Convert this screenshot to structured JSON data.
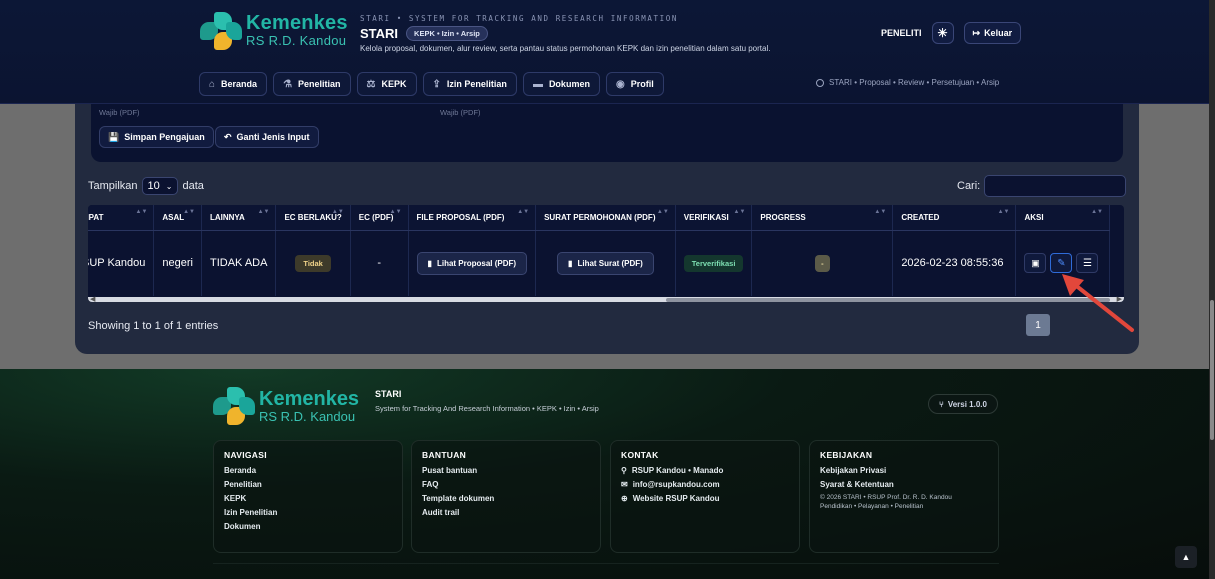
{
  "header": {
    "brand_line1": "Kemenkes",
    "brand_line2": "RS R.D. Kandou",
    "tagline": "STARI • SYSTEM FOR TRACKING AND RESEARCH INFORMATION",
    "app_title": "STARI",
    "pill": "KEPK • Izin • Arsip",
    "subtitle": "Kelola proposal, dokumen, alur review, serta pantau status permohonan KEPK dan izin penelitian dalam satu portal.",
    "role": "PENELITI",
    "logout_label": "Keluar",
    "breadcrumb": "STARI • Proposal • Review • Persetujuan • Arsip"
  },
  "nav": [
    {
      "label": "Beranda",
      "icon": "home-icon"
    },
    {
      "label": "Penelitian",
      "icon": "flask-icon"
    },
    {
      "label": "KEPK",
      "icon": "scale-icon"
    },
    {
      "label": "Izin Penelitian",
      "icon": "upload-icon"
    },
    {
      "label": "Dokumen",
      "icon": "folder-icon"
    },
    {
      "label": "Profil",
      "icon": "user-circle-icon"
    }
  ],
  "form": {
    "hint_left": "Wajib (PDF)",
    "hint_right": "Wajib (PDF)",
    "save_label": "Simpan Pengajuan",
    "switch_label": "Ganti Jenis Input"
  },
  "table_controls": {
    "show_prefix": "Tampilkan",
    "show_value": "10",
    "show_suffix": "data",
    "search_label": "Cari:",
    "search_value": ""
  },
  "table": {
    "headers": [
      "MPAT",
      "ASAL",
      "LAINNYA",
      "EC BERLAKU?",
      "EC (PDF)",
      "FILE PROPOSAL (PDF)",
      "SURAT PERMOHONAN (PDF)",
      "VERIFIKASI",
      "PROGRESS",
      "CREATED",
      "AKSI"
    ],
    "row": {
      "tempat": "SUP Kandou",
      "asal": "negeri",
      "lainnya": "TIDAK ADA",
      "ec_berlaku": "Tidak",
      "ec_pdf": "-",
      "file_proposal": "Lihat Proposal (PDF)",
      "surat": "Lihat Surat (PDF)",
      "verifikasi": "Terverifikasi",
      "progress": "-",
      "created": "2026-02-23 08:55:36"
    }
  },
  "pagination": {
    "info": "Showing 1 to 1 of 1 entries",
    "current_page": "1"
  },
  "footer": {
    "brand_line1": "Kemenkes",
    "brand_line2": "RS R.D. Kandou",
    "title": "STARI",
    "subtitle": "System for Tracking And Research Information • KEPK • Izin • Arsip",
    "version": "Versi 1.0.0",
    "navigasi": {
      "title": "NAVIGASI",
      "items": [
        "Beranda",
        "Penelitian",
        "KEPK",
        "Izin Penelitian",
        "Dokumen"
      ]
    },
    "bantuan": {
      "title": "BANTUAN",
      "items": [
        "Pusat bantuan",
        "FAQ",
        "Template dokumen",
        "Audit trail"
      ]
    },
    "kontak": {
      "title": "KONTAK",
      "items": [
        "RSUP Kandou • Manado",
        "info@rsupkandou.com",
        "Website RSUP Kandou"
      ]
    },
    "kebijakan": {
      "title": "KEBIJAKAN",
      "items": [
        "Kebijakan Privasi",
        "Syarat & Ketentuan"
      ],
      "copyright": "© 2026 STARI • RSUP Prof. Dr. R. D. Kandou",
      "tagline": "Pendidikan • Pelayanan • Penelitian"
    }
  },
  "colors": {
    "header_bg": "#0c1736",
    "brand_teal": "#22b5a5",
    "panel_bg": "#222a3f",
    "arrow": "#e2473b"
  }
}
